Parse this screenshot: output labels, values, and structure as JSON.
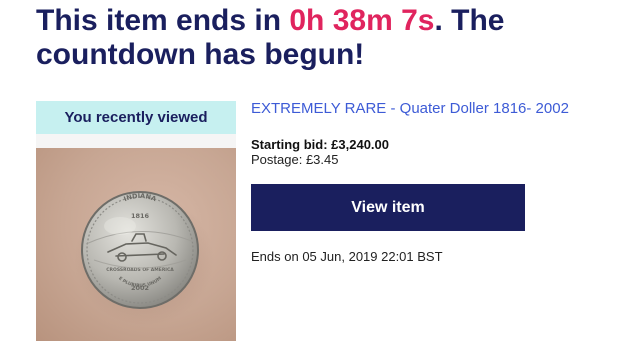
{
  "headline": {
    "prefix": "This item ends in ",
    "countdown": "0h 38m 7s",
    "suffix": ". The countdown has begun!",
    "countdown_color": "#e0245e",
    "text_color": "#1a1f5e"
  },
  "recently_viewed": {
    "banner": "You recently viewed",
    "banner_bg": "#c6f0f0"
  },
  "coin_image": {
    "inscriptions": [
      "INDIANA",
      "1816",
      "CROSSROADS OF AMERICA",
      "2002",
      "E PLURIBUS UNUM"
    ]
  },
  "item": {
    "title": "EXTREMELY RARE - Quater Doller 1816- 2002",
    "starting_bid_label": "Starting bid:",
    "starting_bid_value": "£3,240.00",
    "postage_label": "Postage:",
    "postage_value": "£3.45",
    "view_button": "View item",
    "ends_label": "Ends on",
    "ends_value": "05 Jun, 2019 22:01 BST",
    "link_color": "#3d5bd6",
    "button_color": "#1a1f5e"
  }
}
